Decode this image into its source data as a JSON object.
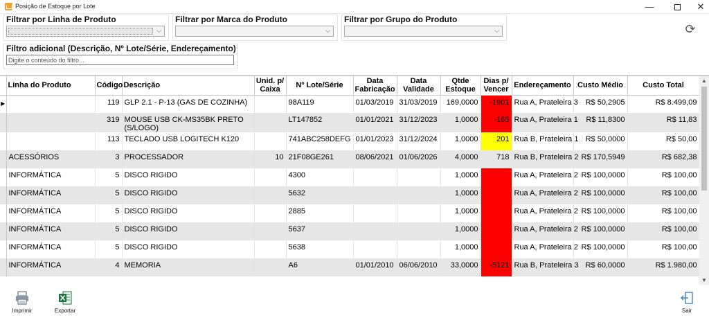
{
  "window": {
    "title": "Posição de Estoque por Lote"
  },
  "filters": {
    "line_label": "Filtrar por Linha de Produto",
    "brand_label": "Filtrar por Marca do Produto",
    "group_label": "Filtrar por Grupo do Produto",
    "extra_label": "Filtro adicional (Descrição, Nº Lote/Série, Endereçamento)",
    "extra_placeholder": "Digite o conteúdo do filtro..."
  },
  "table": {
    "columns": [
      "Linha do Produto",
      "Código",
      "Descrição",
      "Unid. p/ Caixa",
      "Nº Lote/Série",
      "Data Fabricação",
      "Data Validade",
      "Qtde Estoque",
      "Dias p/ Vencer",
      "Endereçamento",
      "Custo Médio",
      "Custo Total"
    ],
    "rows": [
      {
        "linha": "",
        "codigo": "119",
        "descricao": "GLP 2.1 - P-13 (GAS DE COZINHA)",
        "unid": "",
        "lote": "98A119",
        "fab": "01/03/2019",
        "val": "31/03/2019",
        "qtde": "169,0000",
        "dias": "-1901",
        "end": "Rua A, Prateleira 3",
        "medio": "R$ 50,2905",
        "total": "R$ 8.499,09",
        "status": "red"
      },
      {
        "linha": "",
        "codigo": "319",
        "descricao": "MOUSE USB CK-MS35BK PRETO (S/LOGO)",
        "unid": "",
        "lote": "LT147852",
        "fab": "01/01/2021",
        "val": "31/12/2023",
        "qtde": "1,0000",
        "dias": "-165",
        "end": "Rua A, Prateleira 1",
        "medio": "R$ 11,8300",
        "total": "R$ 11,83",
        "status": "red"
      },
      {
        "linha": "",
        "codigo": "113",
        "descricao": "TECLADO USB LOGITECH K120",
        "unid": "",
        "lote": "741ABC258DEFG",
        "fab": "01/01/2023",
        "val": "31/12/2024",
        "qtde": "1,0000",
        "dias": "201",
        "end": "Rua B, Prateleira 1",
        "medio": "R$ 50,0000",
        "total": "R$ 50,00",
        "status": "yellow"
      },
      {
        "linha": "ACESSÓRIOS",
        "codigo": "3",
        "descricao": "PROCESSADOR",
        "unid": "10",
        "lote": "21F08GE261",
        "fab": "08/06/2021",
        "val": "01/06/2026",
        "qtde": "4,0000",
        "dias": "718",
        "end": "Rua B, Prateleira 2",
        "medio": "R$ 170,5949",
        "total": "R$ 682,38",
        "status": ""
      },
      {
        "linha": "INFORMÁTICA",
        "codigo": "5",
        "descricao": "DISCO RIGIDO",
        "unid": "",
        "lote": "4300",
        "fab": "",
        "val": "",
        "qtde": "1,0000",
        "dias": "",
        "end": "Rua A, Prateleira 2",
        "medio": "R$ 100,0000",
        "total": "R$ 100,00",
        "status": "red"
      },
      {
        "linha": "INFORMÁTICA",
        "codigo": "5",
        "descricao": "DISCO RIGIDO",
        "unid": "",
        "lote": "5632",
        "fab": "",
        "val": "",
        "qtde": "1,0000",
        "dias": "",
        "end": "Rua A, Prateleira 2",
        "medio": "R$ 100,0000",
        "total": "R$ 100,00",
        "status": "red"
      },
      {
        "linha": "INFORMÁTICA",
        "codigo": "5",
        "descricao": "DISCO RIGIDO",
        "unid": "",
        "lote": "2885",
        "fab": "",
        "val": "",
        "qtde": "1,0000",
        "dias": "",
        "end": "Rua A, Prateleira 2",
        "medio": "R$ 100,0000",
        "total": "R$ 100,00",
        "status": "red"
      },
      {
        "linha": "INFORMÁTICA",
        "codigo": "5",
        "descricao": "DISCO RIGIDO",
        "unid": "",
        "lote": "5637",
        "fab": "",
        "val": "",
        "qtde": "1,0000",
        "dias": "",
        "end": "Rua A, Prateleira 2",
        "medio": "R$ 100,0000",
        "total": "R$ 100,00",
        "status": "red"
      },
      {
        "linha": "INFORMÁTICA",
        "codigo": "5",
        "descricao": "DISCO RIGIDO",
        "unid": "",
        "lote": "5638",
        "fab": "",
        "val": "",
        "qtde": "1,0000",
        "dias": "",
        "end": "Rua A, Prateleira 2",
        "medio": "R$ 100,0000",
        "total": "R$ 100,00",
        "status": "red"
      },
      {
        "linha": "INFORMÁTICA",
        "codigo": "4",
        "descricao": "MEMORIA",
        "unid": "",
        "lote": "A6",
        "fab": "01/01/2010",
        "val": "06/06/2010",
        "qtde": "33,0000",
        "dias": "-5121",
        "end": "Rua B, Prateleira 3",
        "medio": "R$ 60,0000",
        "total": "R$ 1.980,00",
        "status": "red"
      }
    ]
  },
  "toolbar": {
    "print_label": "Imprimir",
    "export_label": "Exportar",
    "exit_label": "Sair"
  },
  "icons": {
    "refresh": "refresh-icon",
    "print": "printer-icon",
    "export": "excel-icon",
    "exit": "exit-icon"
  },
  "colors": {
    "expired": "#ff0000",
    "warning": "#ffff00",
    "alt_row": "#e6e6e6",
    "excel_green": "#1d6f42"
  }
}
